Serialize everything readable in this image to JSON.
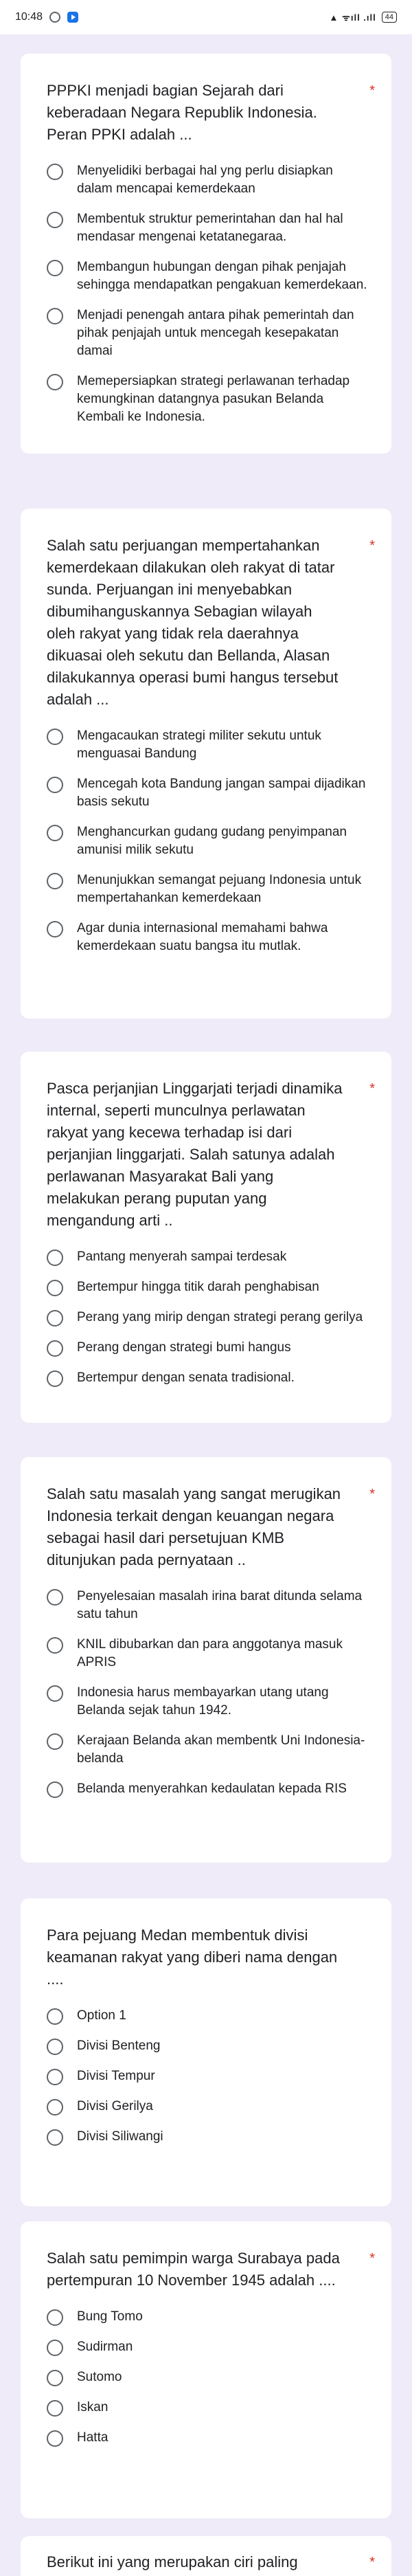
{
  "status": {
    "time": "10:48",
    "battery": "44",
    "signal": "▲ ᯤıll .ıll"
  },
  "questions": [
    {
      "title": "PPPKI menjadi bagian Sejarah dari keberadaan Negara Republik Indonesia. Peran PPKI adalah ...",
      "required": "*",
      "options": [
        "Menyelidiki berbagai hal yng perlu disiapkan dalam mencapai kemerdekaan",
        "Membentuk struktur pemerintahan dan hal hal mendasar mengenai ketatanegaraa.",
        "Membangun hubungan dengan pihak penjajah sehingga mendapatkan pengakuan kemerdekaan.",
        "Menjadi penengah antara pihak pemerintah dan pihak penjajah untuk mencegah kesepakatan damai",
        "Memepersiapkan strategi perlawanan terhadap kemungkinan datangnya pasukan Belanda Kembali ke Indonesia."
      ]
    },
    {
      "title": "Salah satu perjuangan mempertahankan kemerdekaan dilakukan oleh rakyat di tatar sunda. Perjuangan ini menyebabkan dibumihanguskannya Sebagian wilayah oleh rakyat yang tidak rela daerahnya dikuasai oleh sekutu dan Bellanda, Alasan dilakukannya operasi bumi hangus tersebut adalah ...",
      "required": "*",
      "options": [
        "Mengacaukan strategi militer sekutu untuk menguasai Bandung",
        "Mencegah kota Bandung jangan sampai dijadikan basis sekutu",
        "Menghancurkan gudang gudang penyimpanan amunisi milik sekutu",
        "Menunjukkan semangat pejuang Indonesia untuk mempertahankan kemerdekaan",
        "Agar dunia internasional memahami bahwa kemerdekaan suatu bangsa itu mutlak."
      ]
    },
    {
      "title": "Pasca perjanjian Linggarjati terjadi dinamika internal, seperti munculnya perlawatan rakyat yang kecewa terhadap isi dari perjanjian linggarjati. Salah satunya adalah perlawanan Masyarakat Bali yang melakukan perang puputan yang mengandung arti ..",
      "required": "*",
      "options": [
        "Pantang menyerah sampai terdesak",
        "Bertempur hingga titik darah penghabisan",
        "Perang yang mirip dengan strategi perang gerilya",
        "Perang dengan strategi bumi hangus",
        "Bertempur dengan senata tradisional."
      ]
    },
    {
      "title": "Salah satu masalah yang sangat merugikan Indonesia terkait dengan keuangan negara sebagai hasil dari persetujuan KMB ditunjukan pada pernyataan ..",
      "required": "*",
      "options": [
        "Penyelesaian masalah irina barat ditunda selama satu tahun",
        "KNIL dibubarkan dan para anggotanya masuk APRIS",
        "Indonesia harus membayarkan utang utang Belanda sejak tahun 1942.",
        "Kerajaan Belanda akan membentk Uni Indonesia-belanda",
        "Belanda menyerahkan kedaulatan kepada RIS"
      ]
    },
    {
      "title": "Para pejuang Medan membentuk divisi keamanan rakyat yang diberi nama dengan ....",
      "required": "",
      "options": [
        "Option 1",
        "Divisi Benteng",
        "Divisi Tempur",
        "Divisi Gerilya",
        "Divisi Siliwangi"
      ]
    },
    {
      "title": "Salah satu pemimpin warga Surabaya pada pertempuran 10 November 1945 adalah ....",
      "required": "*",
      "options": [
        "Bung Tomo",
        "Sudirman",
        "Sutomo",
        "Iskan",
        "Hatta"
      ]
    },
    {
      "title": "Berikut ini yang merupakan ciri paling",
      "required": "*",
      "options": []
    }
  ]
}
